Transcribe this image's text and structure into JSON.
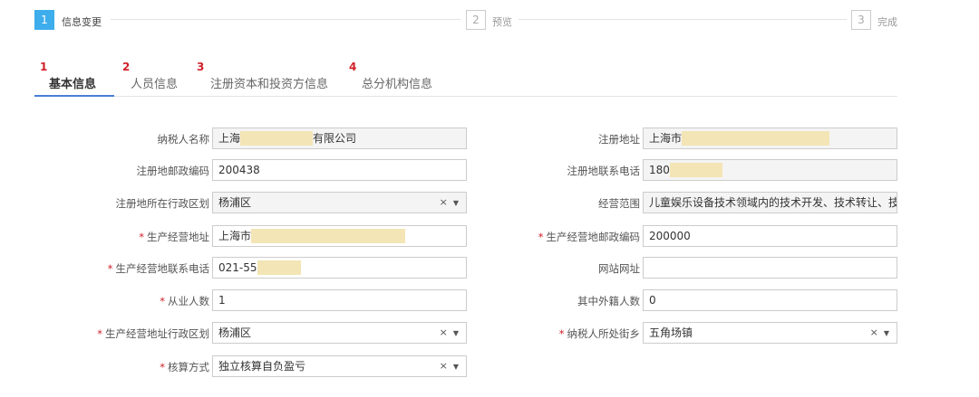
{
  "steps": [
    {
      "num": "1",
      "label": "信息变更",
      "active": true
    },
    {
      "num": "2",
      "label": "预览"
    },
    {
      "num": "3",
      "label": "完成"
    }
  ],
  "tabs": [
    {
      "num": "1",
      "label": "基本信息"
    },
    {
      "num": "2",
      "label": "人员信息"
    },
    {
      "num": "3",
      "label": "注册资本和投资方信息"
    },
    {
      "num": "4",
      "label": "总分机构信息"
    }
  ],
  "form": {
    "taxpayer_name": {
      "label": "纳税人名称",
      "prefix": "上海",
      "suffix": "有限公司"
    },
    "reg_address": {
      "label": "注册地址",
      "prefix": "上海市"
    },
    "reg_postcode": {
      "label": "注册地邮政编码",
      "value": "200438"
    },
    "reg_phone": {
      "label": "注册地联系电话",
      "prefix": "180"
    },
    "reg_district": {
      "label": "注册地所在行政区划",
      "value": "杨浦区"
    },
    "business_scope": {
      "label": "经营范围",
      "value": "儿童娱乐设备技术领域内的技术开发、技术转让、技术"
    },
    "prod_address": {
      "label": "生产经营地址",
      "prefix": "上海市",
      "required": true
    },
    "prod_postcode": {
      "label": "生产经营地邮政编码",
      "value": "200000",
      "required": true
    },
    "prod_phone": {
      "label": "生产经营地联系电话",
      "prefix": "021-55",
      "required": true
    },
    "website": {
      "label": "网站网址",
      "value": ""
    },
    "employees": {
      "label": "从业人数",
      "value": "1",
      "required": true
    },
    "foreign_employees": {
      "label": "其中外籍人数",
      "value": "0"
    },
    "prod_district": {
      "label": "生产经营地址行政区划",
      "value": "杨浦区",
      "required": true
    },
    "street": {
      "label": "纳税人所处街乡",
      "value": "五角场镇",
      "required": true
    },
    "accounting": {
      "label": "核算方式",
      "value": "独立核算自负盈亏",
      "required": true
    }
  },
  "select_controls": {
    "clear": "×",
    "caret": "▼"
  },
  "required_mark": "*",
  "colors": {
    "accent": "#3dadec",
    "tab_underline": "#4a7fd6",
    "required": "#d0202a",
    "redaction": "#f3e5b5"
  }
}
